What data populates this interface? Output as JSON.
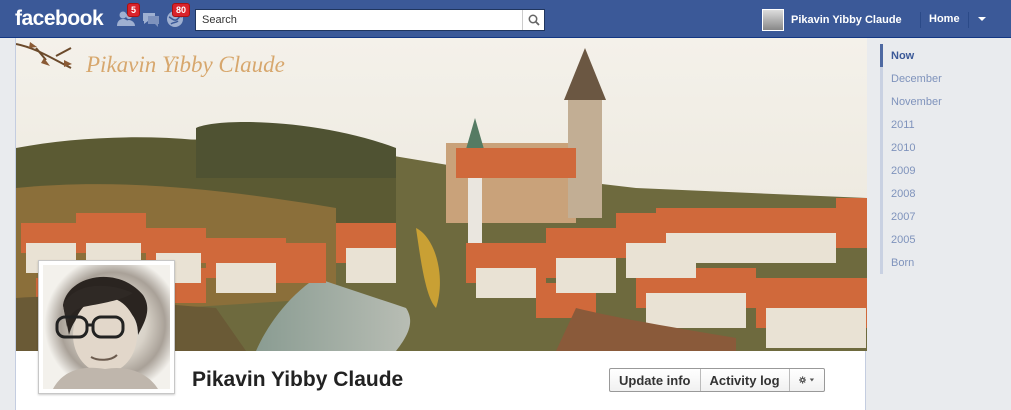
{
  "topbar": {
    "logo": "facebook",
    "friend_requests_badge": "5",
    "notifications_badge": "80",
    "search_placeholder": "Search",
    "user_name": "Pikavin Yibby Claude",
    "home_label": "Home"
  },
  "cover": {
    "signature": "Pikavin Yibby Claude"
  },
  "profile": {
    "name": "Pikavin Yibby Claude",
    "update_info_label": "Update info",
    "activity_log_label": "Activity log"
  },
  "timeline": {
    "items": [
      "Now",
      "December",
      "November",
      "2011",
      "2010",
      "2009",
      "2008",
      "2007",
      "2005",
      "Born"
    ]
  },
  "colors": {
    "brand_blue": "#3b5998",
    "badge_red": "#d9232c",
    "background": "#e9ebee"
  }
}
